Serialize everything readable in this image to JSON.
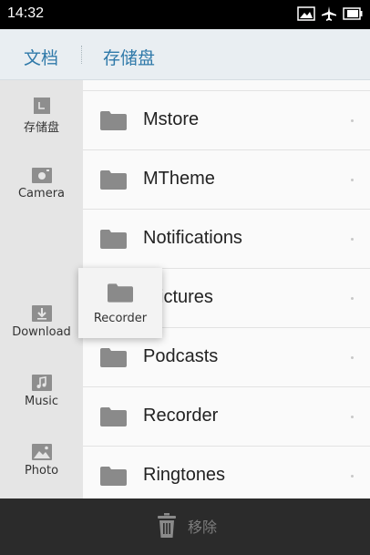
{
  "status": {
    "time": "14:32",
    "icons": [
      "image-icon",
      "airplane-mode-icon",
      "battery-icon"
    ]
  },
  "header": {
    "root_label": "文档",
    "current_label": "存储盘"
  },
  "sidebar": {
    "items": [
      {
        "label": "存储盘",
        "icon": "sd-card-icon"
      },
      {
        "label": "Camera",
        "icon": "camera-icon"
      },
      {
        "label": "Download",
        "icon": "download-icon"
      },
      {
        "label": "Music",
        "icon": "music-icon"
      },
      {
        "label": "Photo",
        "icon": "photo-icon"
      }
    ]
  },
  "folders": [
    {
      "name": "Mstore"
    },
    {
      "name": "MTheme"
    },
    {
      "name": "Notifications"
    },
    {
      "name": "ictures"
    },
    {
      "name": "Podcasts"
    },
    {
      "name": "Recorder"
    },
    {
      "name": "Ringtones"
    }
  ],
  "drag_card": {
    "label": "Recorder",
    "icon": "folder-icon"
  },
  "bottom": {
    "remove_label": "移除",
    "icon": "trash-icon"
  },
  "colors": {
    "accent": "#2f79a9",
    "status_bar": "#000000",
    "bottom_bar": "#2b2b2b",
    "folder_icon": "#8a8a8a"
  }
}
